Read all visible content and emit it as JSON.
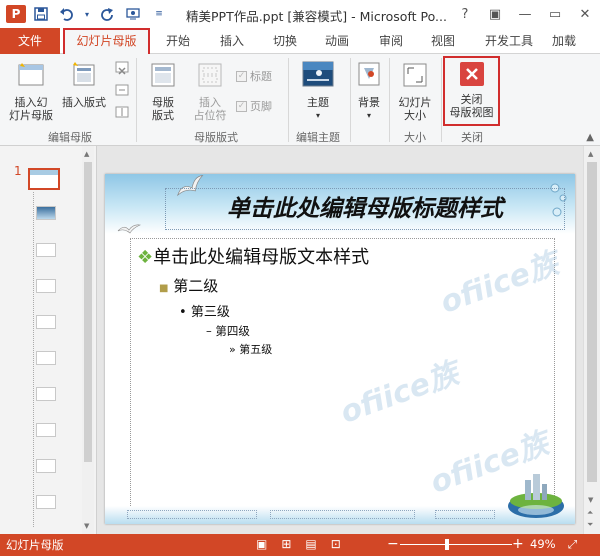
{
  "titlebar": {
    "app_icon": "P",
    "title": "精美PPT作品.ppt [兼容模式] - Microsoft Po...",
    "qat": [
      "save-icon",
      "undo-icon",
      "redo-icon",
      "customize-icon"
    ],
    "win": [
      "?",
      "▣",
      "—",
      "▭",
      "✕"
    ]
  },
  "tabs": {
    "file": "文件",
    "active": "幻灯片母版",
    "items": [
      "开始",
      "插入",
      "切换",
      "动画",
      "审阅",
      "视图",
      "开发工具",
      "加载"
    ]
  },
  "ribbon": {
    "insert_master_1": "插入幻",
    "insert_master_2": "灯片母版",
    "insert_layout": "插入版式",
    "group_edit_master": "编辑母版",
    "master_layout_1": "母版",
    "master_layout_2": "版式",
    "insert_placeholder_1": "插入",
    "insert_placeholder_2": "占位符",
    "chk_title": "标题",
    "chk_footer": "页脚",
    "group_master_layout": "母版版式",
    "theme": "主题",
    "group_edit_theme": "编辑主题",
    "background": "背景",
    "slide_size_1": "幻灯片",
    "slide_size_2": "大小",
    "group_size": "大小",
    "close_1": "关闭",
    "close_2": "母版视图",
    "group_close": "关闭"
  },
  "thumbs": {
    "first_num": "1"
  },
  "slide": {
    "title": "单击此处编辑母版标题样式",
    "level1": "单击此处编辑母版文本样式",
    "level2": "第二级",
    "level3": "第三级",
    "level4": "第四级",
    "level5": "第五级",
    "bullet1": "❖",
    "bullet2": "■",
    "bullet3": "•",
    "bullet4": "–",
    "bullet5": "»"
  },
  "watermark": "ofiice族",
  "status": {
    "view_name": "幻灯片母版",
    "zoom": "49%",
    "zoom_fraction": 0.42
  }
}
